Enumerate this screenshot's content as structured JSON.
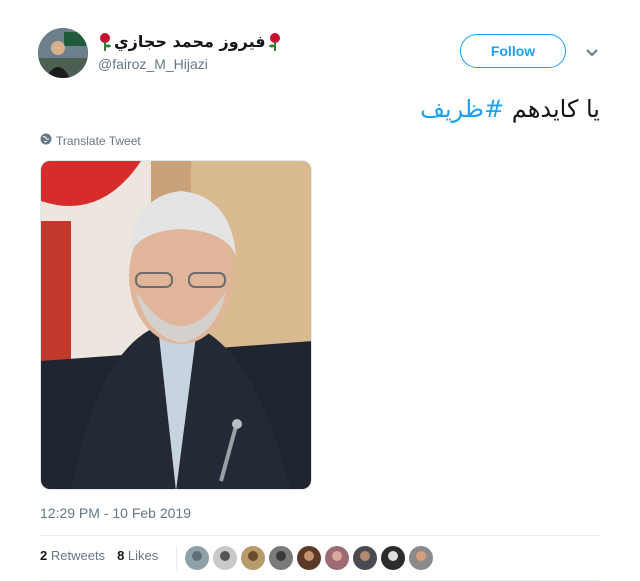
{
  "user": {
    "display_name": "فيروز محمد حجازي",
    "handle": "@fairoz_M_Hijazi"
  },
  "follow_button": {
    "label": "Follow"
  },
  "tweet": {
    "text": "يا كايدهم ",
    "hashtag": "#ظريف"
  },
  "translate": {
    "label": "Translate Tweet"
  },
  "timestamp": "12:29 PM - 10 Feb 2019",
  "stats": {
    "retweets_count": "2",
    "retweets_label": "Retweets",
    "likes_count": "8",
    "likes_label": "Likes"
  },
  "colors": {
    "accent": "#1da1f2",
    "rose": "#c8102e"
  },
  "icons": [
    "rose-icon",
    "chevron-down-icon",
    "globe-icon"
  ]
}
